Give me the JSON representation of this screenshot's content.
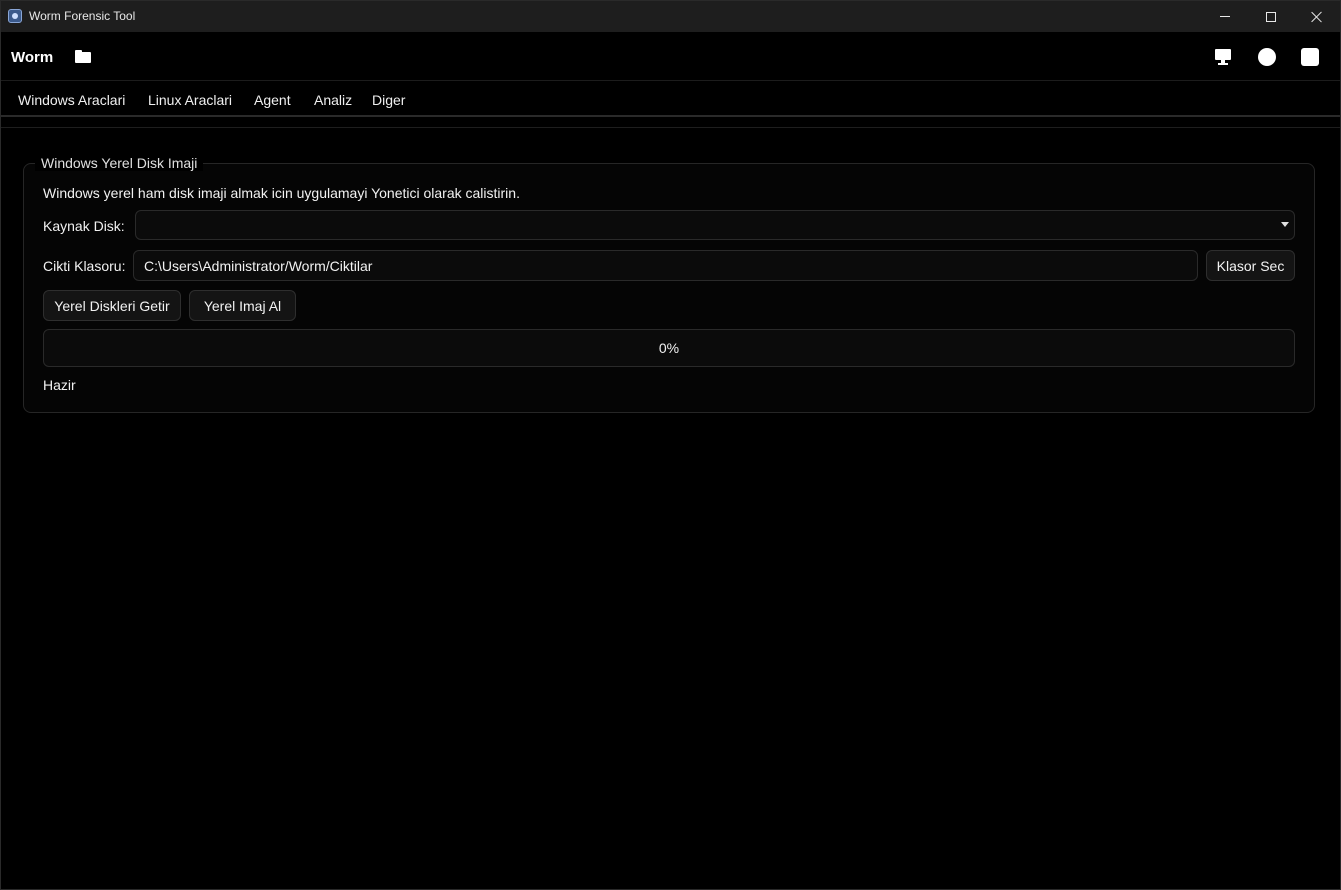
{
  "window": {
    "title": "Worm Forensic Tool"
  },
  "header": {
    "brand": "Worm"
  },
  "menu": {
    "items": [
      "Windows Araclari",
      "Linux Araclari",
      "Agent",
      "Analiz",
      "Diger"
    ]
  },
  "group": {
    "title": "Windows Yerel Disk Imaji",
    "info": "Windows yerel ham disk imaji almak icin uygulamayi Yonetici olarak calistirin.",
    "source_disk_label": "Kaynak Disk:",
    "source_disk_value": "",
    "output_folder_label": "Cikti Klasoru:",
    "output_folder_value": "C:\\Users\\Administrator/Worm/Ciktilar",
    "browse_button": "Klasor Sec",
    "fetch_disks_button": "Yerel Diskleri Getir",
    "take_image_button": "Yerel Imaj Al",
    "progress_value": 0,
    "progress_text": "0%",
    "status": "Hazir"
  }
}
